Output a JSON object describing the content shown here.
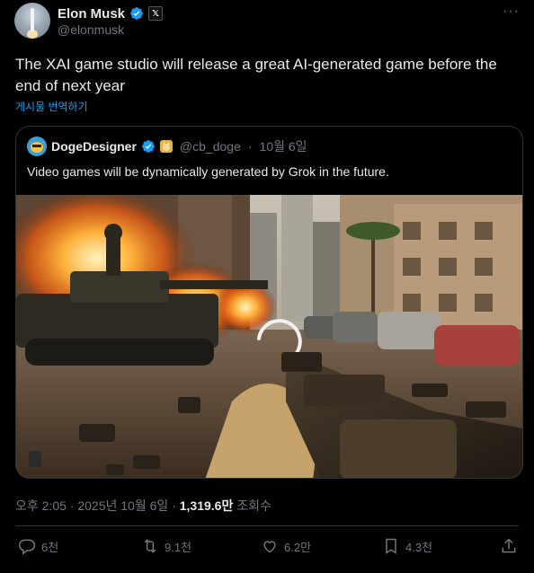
{
  "author": {
    "display_name": "Elon Musk",
    "handle": "@elonmusk",
    "verified_badge_color": "#1d9bf0",
    "affiliate_badge_icon": "x-logo-icon",
    "affiliate_badge_label": "𝕏"
  },
  "menu": {
    "more_label": "···"
  },
  "tweet": {
    "text": "The XAI game studio will release a great AI-generated game before the end of next year",
    "translate_label": "게시물 번역하기"
  },
  "quote": {
    "display_name": "DogeDesigner",
    "handle": "@cb_doge",
    "separator": "·",
    "date": "10월 6일",
    "text": "Video games will be dynamically generated by Grok in the future."
  },
  "meta": {
    "time": "오후 2:05",
    "separator": "·",
    "date": "2025년 10월 6일",
    "views": "1,319.6만",
    "views_label": "조회수"
  },
  "actions": {
    "reply_count": "6천",
    "repost_count": "9.1천",
    "like_count": "6.2만",
    "bookmark_count": "4.3천"
  },
  "colors": {
    "background": "#000000",
    "text_primary": "#e7e9ea",
    "text_secondary": "#71767b",
    "link": "#1d9bf0",
    "border": "#2f3336"
  }
}
